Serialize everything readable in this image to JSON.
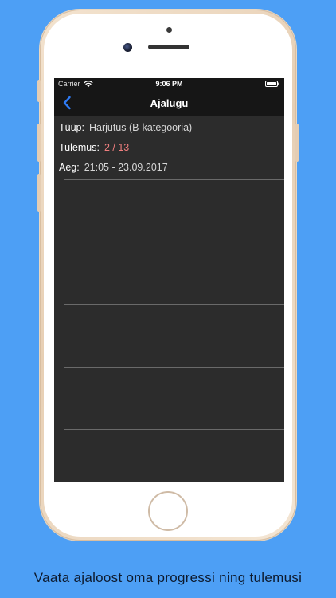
{
  "status_bar": {
    "carrier": "Carrier",
    "time": "9:06 PM"
  },
  "nav": {
    "title": "Ajalugu",
    "back_icon": "chevron-left-icon",
    "accent": "#2f7cf6"
  },
  "history": {
    "type_label": "Tüüp:",
    "type_value": "Harjutus (B-kategooria)",
    "result_label": "Tulemus:",
    "result_value": "2 / 13",
    "result_color": "#f07f7f",
    "time_label": "Aeg:",
    "time_value": "21:05 - 23.09.2017"
  },
  "caption": "Vaata ajaloost oma progressi ning tulemusi",
  "colors": {
    "background": "#4d9ff5",
    "screen": "#2c2c2c",
    "bar": "#161616"
  }
}
